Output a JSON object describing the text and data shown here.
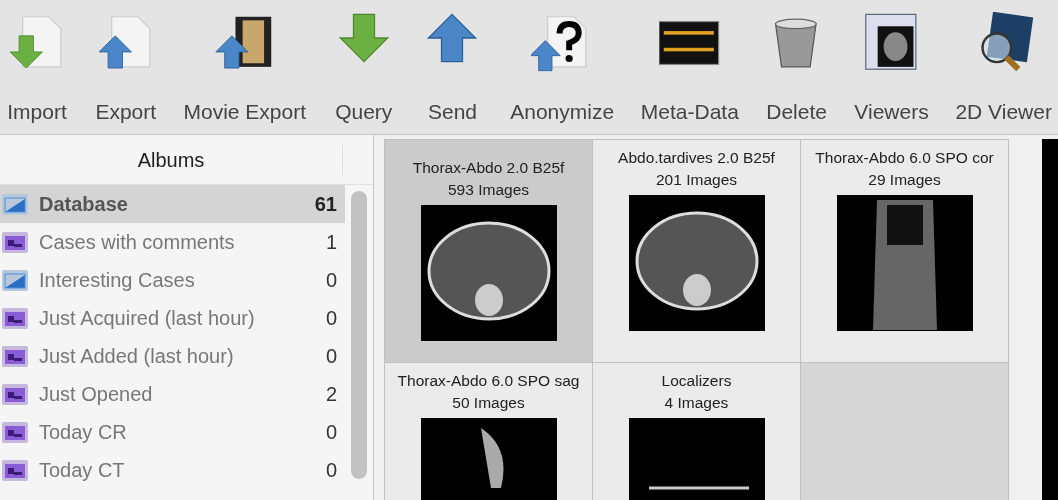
{
  "toolbar": [
    {
      "label": "Import"
    },
    {
      "label": "Export"
    },
    {
      "label": "Movie Export"
    },
    {
      "label": "Query"
    },
    {
      "label": "Send"
    },
    {
      "label": "Anonymize"
    },
    {
      "label": "Meta-Data"
    },
    {
      "label": "Delete"
    },
    {
      "label": "Viewers"
    },
    {
      "label": "2D Viewer"
    }
  ],
  "albums": {
    "header": "Albums",
    "items": [
      {
        "name": "Database",
        "count": "61",
        "kind": "folder",
        "selected": true
      },
      {
        "name": "Cases with comments",
        "count": "1",
        "kind": "smart",
        "selected": false
      },
      {
        "name": "Interesting Cases",
        "count": "0",
        "kind": "folder",
        "selected": false
      },
      {
        "name": "Just Acquired (last hour)",
        "count": "0",
        "kind": "smart",
        "selected": false
      },
      {
        "name": "Just Added (last hour)",
        "count": "0",
        "kind": "smart",
        "selected": false
      },
      {
        "name": "Just Opened",
        "count": "2",
        "kind": "smart",
        "selected": false
      },
      {
        "name": "Today CR",
        "count": "0",
        "kind": "smart",
        "selected": false
      },
      {
        "name": "Today CT",
        "count": "0",
        "kind": "smart",
        "selected": false
      }
    ]
  },
  "series": [
    {
      "title": "Thorax-Abdo 2.0 B25f",
      "count": "593 Images",
      "selected": true
    },
    {
      "title": "Abdo.tardives 2.0 B25f",
      "count": "201 Images",
      "selected": false
    },
    {
      "title": "Thorax-Abdo 6.0 SPO cor",
      "count": "29 Images",
      "selected": false
    },
    {
      "title": "Thorax-Abdo 6.0 SPO sag",
      "count": "50 Images",
      "selected": false
    },
    {
      "title": "Localizers",
      "count": "4 Images",
      "selected": false
    }
  ]
}
